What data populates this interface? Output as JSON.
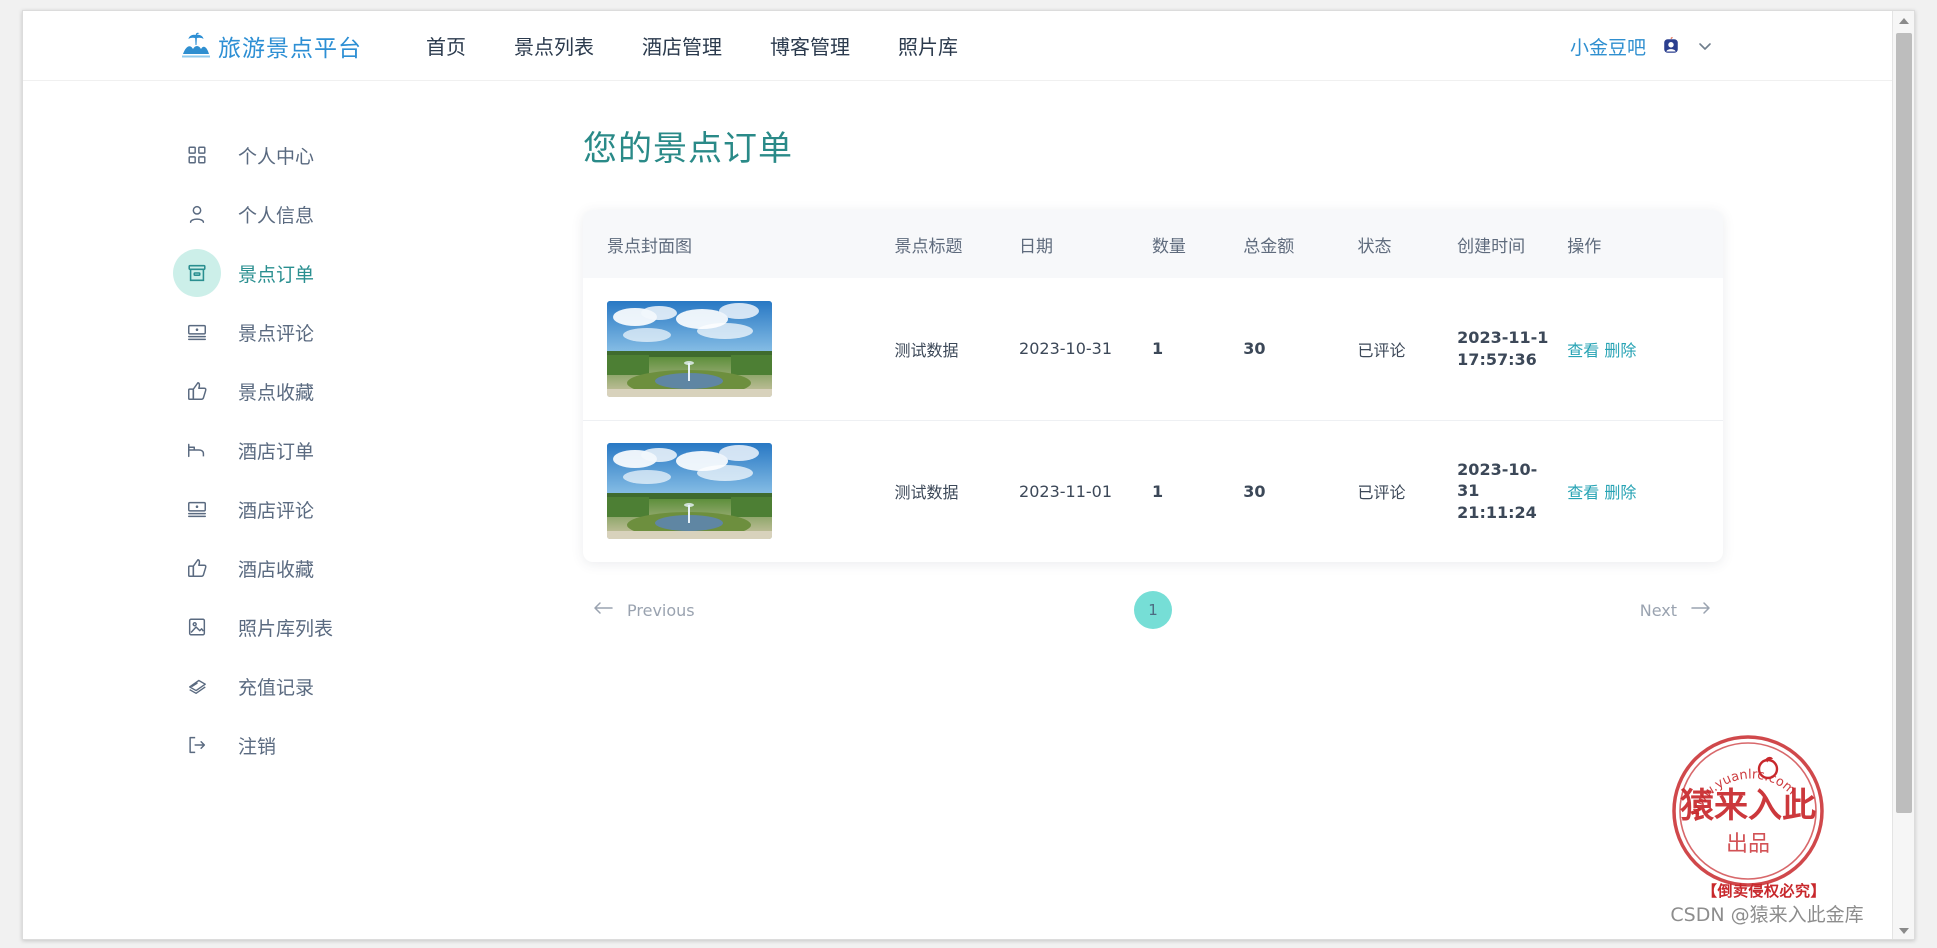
{
  "header": {
    "brand_name": "旅游景点平台",
    "logo_icon": "island-palm-icon",
    "nav": [
      {
        "label": "首页",
        "name": "nav-home"
      },
      {
        "label": "景点列表",
        "name": "nav-attraction-list"
      },
      {
        "label": "酒店管理",
        "name": "nav-hotel-management"
      },
      {
        "label": "博客管理",
        "name": "nav-blog-management"
      },
      {
        "label": "照片库",
        "name": "nav-photo-gallery"
      }
    ],
    "username": "小金豆吧",
    "avatar_icon": "user-avatar-icon",
    "chevron_icon": "chevron-down-icon"
  },
  "sidebar": {
    "items": [
      {
        "label": "个人中心",
        "icon": "grid-icon",
        "name": "sidebar-item-personal-center",
        "active": false
      },
      {
        "label": "个人信息",
        "icon": "user-icon",
        "name": "sidebar-item-personal-info",
        "active": false
      },
      {
        "label": "景点订单",
        "icon": "box-icon",
        "name": "sidebar-item-attraction-orders",
        "active": true
      },
      {
        "label": "景点评论",
        "icon": "comment-card-icon",
        "name": "sidebar-item-attraction-comments",
        "active": false
      },
      {
        "label": "景点收藏",
        "icon": "thumbs-up-icon",
        "name": "sidebar-item-attraction-favorites",
        "active": false
      },
      {
        "label": "酒店订单",
        "icon": "bed-icon",
        "name": "sidebar-item-hotel-orders",
        "active": false
      },
      {
        "label": "酒店评论",
        "icon": "comment-card-icon",
        "name": "sidebar-item-hotel-comments",
        "active": false
      },
      {
        "label": "酒店收藏",
        "icon": "thumbs-up-icon",
        "name": "sidebar-item-hotel-favorites",
        "active": false
      },
      {
        "label": "照片库列表",
        "icon": "image-icon",
        "name": "sidebar-item-photo-gallery-list",
        "active": false
      },
      {
        "label": "充值记录",
        "icon": "card-stack-icon",
        "name": "sidebar-item-recharge-records",
        "active": false
      },
      {
        "label": "注销",
        "icon": "logout-icon",
        "name": "sidebar-item-logout",
        "active": false
      }
    ]
  },
  "main": {
    "title": "您的景点订单",
    "table": {
      "columns": [
        "景点封面图",
        "景点标题",
        "日期",
        "数量",
        "总金额",
        "状态",
        "创建时间",
        "操作"
      ],
      "rows": [
        {
          "image_alt": "景点封面图",
          "title": "测试数据",
          "date": "2023-10-31",
          "quantity": "1",
          "amount": "30",
          "status": "已评论",
          "create_time": "2023-11-1 17:57:36",
          "action_view": "查看",
          "action_delete": "删除"
        },
        {
          "image_alt": "景点封面图",
          "title": "测试数据",
          "date": "2023-11-01",
          "quantity": "1",
          "amount": "30",
          "status": "已评论",
          "create_time": "2023-10-31 21:11:24",
          "action_view": "查看",
          "action_delete": "删除"
        }
      ]
    },
    "pagination": {
      "previous": "Previous",
      "next": "Next",
      "current_page": "1",
      "prev_icon": "arrow-left-icon",
      "next_icon": "arrow-right-icon"
    }
  },
  "watermark": {
    "stamp_url_text": "www.yuanlrc.com",
    "stamp_main": "猿来入此",
    "stamp_sub": "出品",
    "warning": "【倒卖侵权必究】",
    "credit": "CSDN @猿来入此金库"
  },
  "colors": {
    "brand_blue": "#2d8fd4",
    "accent_teal": "#2a8a88",
    "link_teal": "#27a3b4",
    "pager_active": "#76ded6",
    "sidebar_active_bg": "#ccefe9",
    "stamp_red": "#c8282c"
  }
}
